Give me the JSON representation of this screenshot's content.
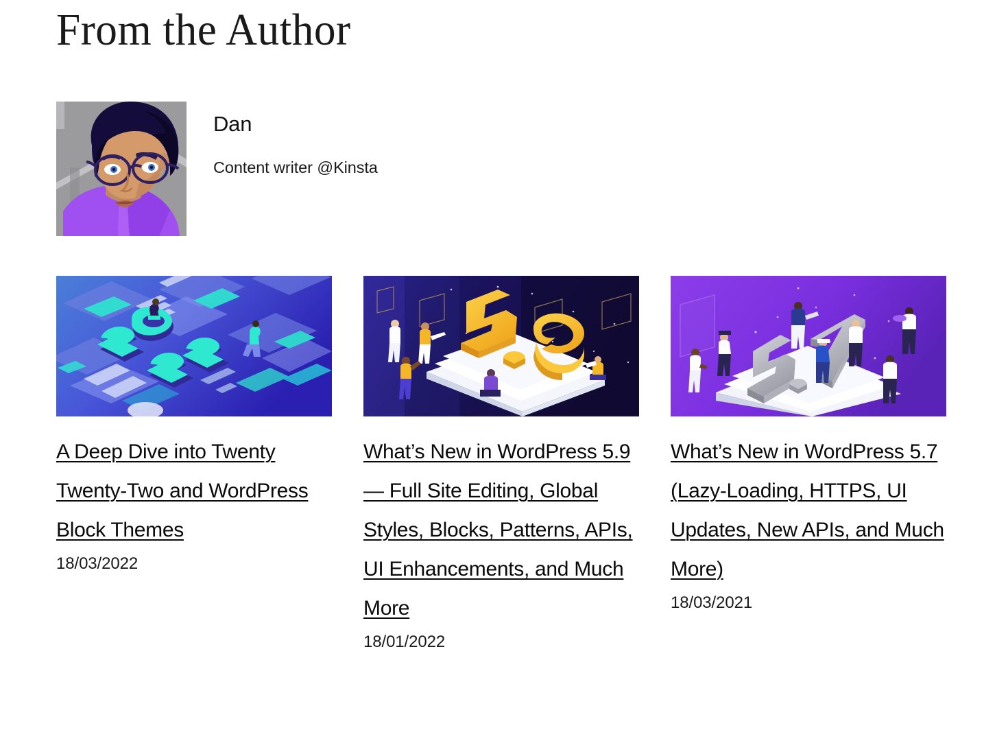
{
  "section": {
    "heading": "From the Author"
  },
  "author": {
    "name": "Dan",
    "role": "Content writer @Kinsta",
    "avatar_alt": "author-avatar-illustration"
  },
  "posts": [
    {
      "title": "A Deep Dive into Twenty Twenty-Two and WordPress Block Themes",
      "date": "18/03/2022",
      "thumb_alt": "isometric-2022-illustration"
    },
    {
      "title": "What’s New in WordPress 5.9 — Full Site Editing, Global Styles, Blocks, Patterns, APIs, UI Enhancements, and Much More",
      "date": "18/01/2022",
      "thumb_alt": "isometric-wordpress-5-9-illustration"
    },
    {
      "title": "What’s New in WordPress 5.7 (Lazy-Loading, HTTPS, UI Updates, New APIs, and Much More)",
      "date": "18/03/2021",
      "thumb_alt": "isometric-wordpress-5-7-illustration"
    }
  ],
  "colors": {
    "page_background": "#ffffff",
    "text_primary": "#0a0a0a",
    "avatar_background": "#9b9b9e",
    "avatar_hair": "#140c3a",
    "avatar_skin": "#d49a6a",
    "avatar_shirt": "#a04ff0",
    "card1_gradient_start": "#4a7fd8",
    "card1_gradient_end": "#2a1fb0",
    "card1_accent": "#2fe8d0",
    "card2_background": "#1b1460",
    "card2_accent": "#f5b728",
    "card3_gradient_start": "#8b3de8",
    "card3_gradient_end": "#5a23b8",
    "card3_accent": "#b9b9c4"
  }
}
